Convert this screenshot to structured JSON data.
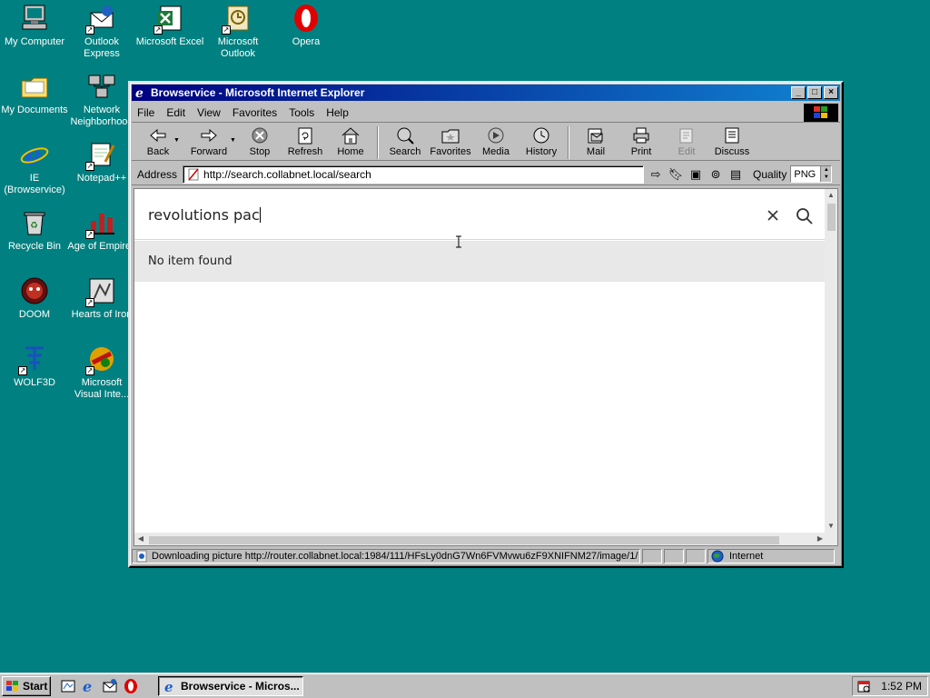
{
  "desktop": {
    "icons": [
      {
        "label": "My Computer"
      },
      {
        "label": "Outlook Express"
      },
      {
        "label": "Microsoft Excel"
      },
      {
        "label": "Microsoft Outlook"
      },
      {
        "label": "Opera"
      },
      {
        "label": "My Documents"
      },
      {
        "label": "Network Neighborhood"
      },
      {
        "label": "IE (Browservice)"
      },
      {
        "label": "Notepad++"
      },
      {
        "label": "Recycle Bin"
      },
      {
        "label": "Age of Empires"
      },
      {
        "label": "DOOM"
      },
      {
        "label": "Hearts of Iron"
      },
      {
        "label": "WOLF3D"
      },
      {
        "label": "Microsoft Visual Inte..."
      }
    ]
  },
  "window": {
    "title": "Browservice - Microsoft Internet Explorer",
    "menu": [
      "File",
      "Edit",
      "View",
      "Favorites",
      "Tools",
      "Help"
    ],
    "toolbar": [
      {
        "label": "Back",
        "icon": "back-arrow-icon"
      },
      {
        "label": "Forward",
        "icon": "forward-arrow-icon"
      },
      {
        "label": "Stop",
        "icon": "stop-icon"
      },
      {
        "label": "Refresh",
        "icon": "refresh-icon"
      },
      {
        "label": "Home",
        "icon": "home-icon"
      },
      {
        "label": "Search",
        "icon": "search-globe-icon"
      },
      {
        "label": "Favorites",
        "icon": "favorites-folder-icon"
      },
      {
        "label": "Media",
        "icon": "media-icon"
      },
      {
        "label": "History",
        "icon": "history-icon"
      },
      {
        "label": "Mail",
        "icon": "mail-icon"
      },
      {
        "label": "Print",
        "icon": "printer-icon"
      },
      {
        "label": "Edit",
        "icon": "edit-icon"
      },
      {
        "label": "Discuss",
        "icon": "discuss-icon"
      }
    ],
    "address": {
      "label": "Address",
      "url": "http://search.collabnet.local/search"
    },
    "quality": {
      "label": "Quality",
      "value": "PNG"
    },
    "page": {
      "search_query": "revolutions pac",
      "result_message": "No item found"
    },
    "status": {
      "text": "Downloading picture http://router.collabnet.local:1984/111/HFsLy0dnG7Wn6FVMvwu6zF9XNIFNM27/image/1/",
      "zone": "Internet"
    }
  },
  "taskbar": {
    "start_label": "Start",
    "task_label": "Browservice - Micros...",
    "clock": "1:52 PM"
  },
  "colors": {
    "desktop": "#008080",
    "titlebar": "#000080",
    "result_row": "#e8e8e8"
  }
}
